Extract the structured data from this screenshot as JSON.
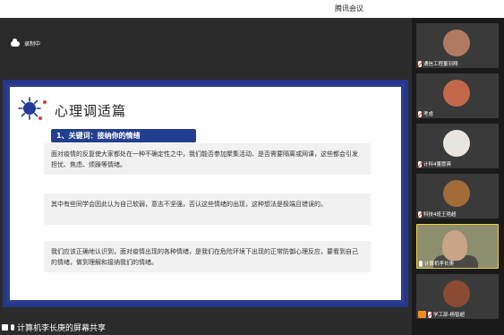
{
  "window": {
    "title": "腾讯会议"
  },
  "recording": {
    "label": "录制中"
  },
  "slide": {
    "title": "心理调适篇",
    "keyword": "1、关键词：接纳你的情绪",
    "paragraphs": [
      "面对疫情的反复使大家都处在一种不确定性之中，我们能否参加聚集活动、是否需要隔离或网课，这些都会引发担忧、焦虑、烦躁等情绪。",
      "其中有些同学会因此认为自己软弱，意志不坚强，否认这些情绪的出现，这种想法是极端且错误的。",
      "我们应该正确地认识到，面对疫情出现的各种情绪，是我们在危险环境下出现的正常防御心理反应，要看到自己的情绪，做到理解和接纳我们的情绪。"
    ]
  },
  "share": {
    "label": "计算机李长庚的屏幕共享"
  },
  "participants": [
    {
      "name": "通信工程董羽翔",
      "mic": "muted",
      "avatar_color": "#b07a62"
    },
    {
      "name": "考虑",
      "mic": "muted",
      "avatar_color": "#c4684a"
    },
    {
      "name": "计科4董愿爽",
      "mic": "muted",
      "avatar_color": "#e8e4e0"
    },
    {
      "name": "科技4班王艳超",
      "mic": "muted",
      "avatar_color": "#a26b38"
    },
    {
      "name": "计算机李长庚",
      "mic": "active",
      "avatar_color": "#c9a487"
    },
    {
      "name": "学工部-杨智超",
      "mic": "muted",
      "avatar_color": "#8c4a33"
    }
  ]
}
